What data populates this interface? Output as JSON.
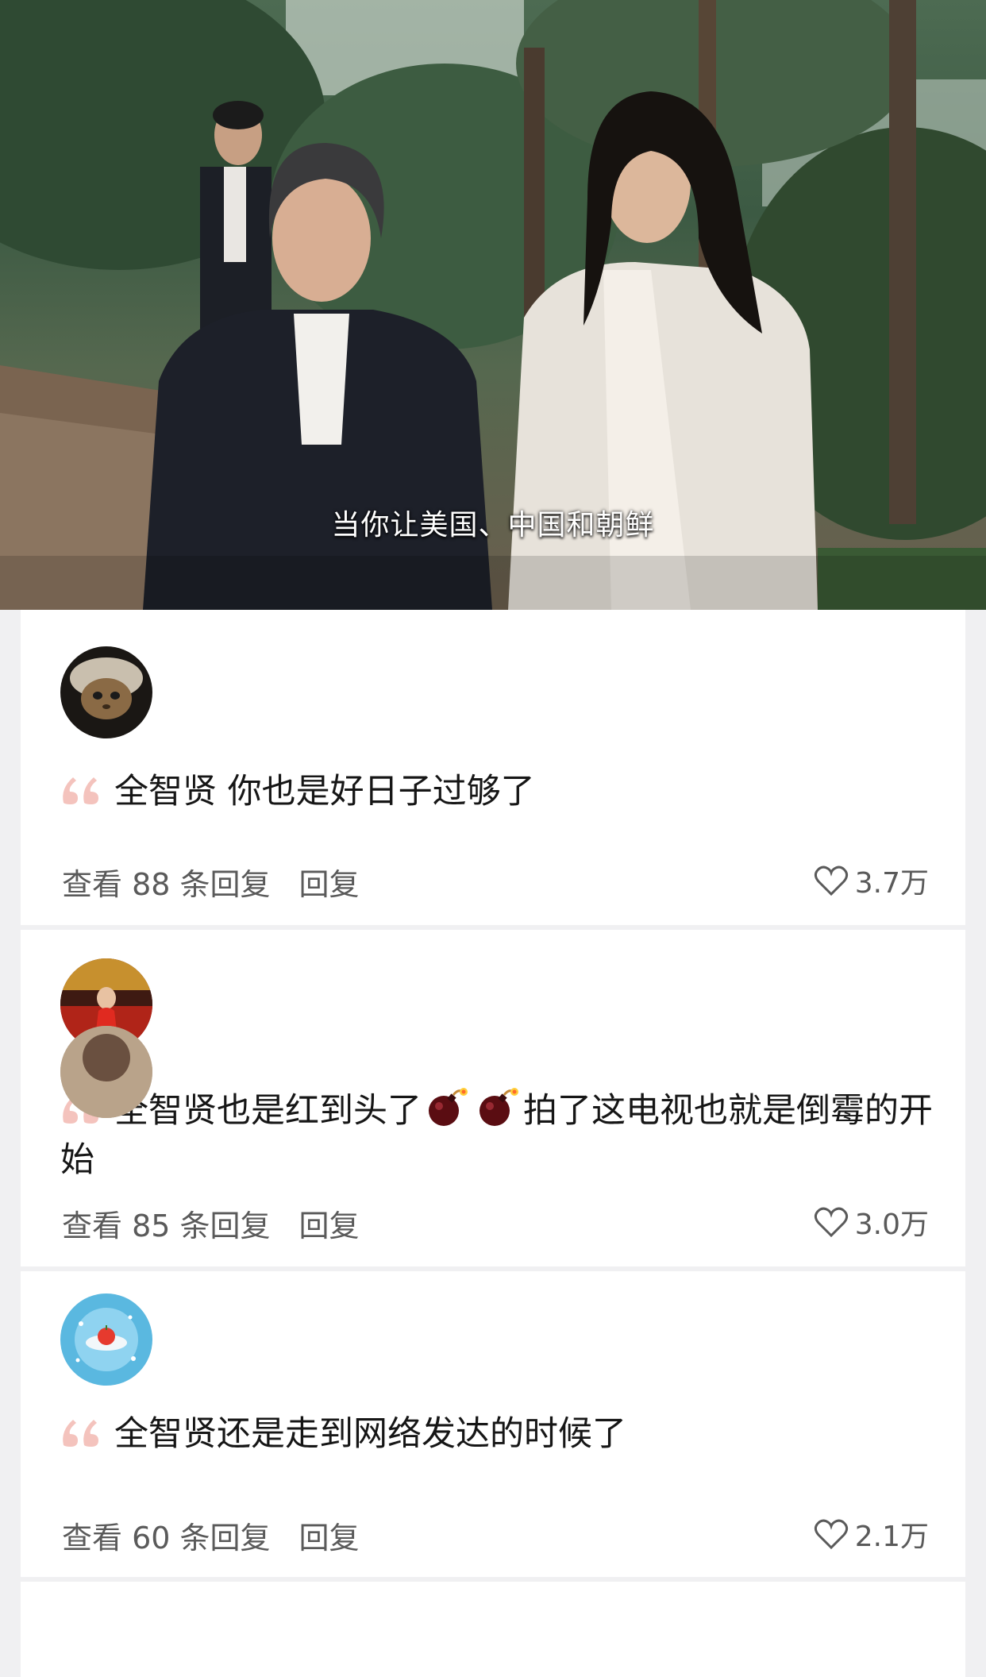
{
  "video": {
    "subtitle": "当你让美国、中国和朝鲜"
  },
  "comments": [
    {
      "text": "全智贤 你也是好日子过够了",
      "view_replies": "查看 88 条回复",
      "reply_label": "回复",
      "likes": "3.7万"
    },
    {
      "text_before_emoji": "全智贤也是红到头了",
      "text_after_emoji": "拍了这电视也就是倒霉的开始",
      "emoji": [
        "bomb-icon",
        "bomb-icon"
      ],
      "view_replies": "查看 85 条回复",
      "reply_label": "回复",
      "likes": "3.0万"
    },
    {
      "text": "全智贤还是走到网络发达的时候了",
      "view_replies": "查看 60 条回复",
      "reply_label": "回复",
      "likes": "2.1万"
    }
  ],
  "colors": {
    "quote_mark": "#f4c3bd",
    "meta_text": "#5a5a5a",
    "card_bg": "#ffffff",
    "page_bg": "#f0f0f2"
  }
}
